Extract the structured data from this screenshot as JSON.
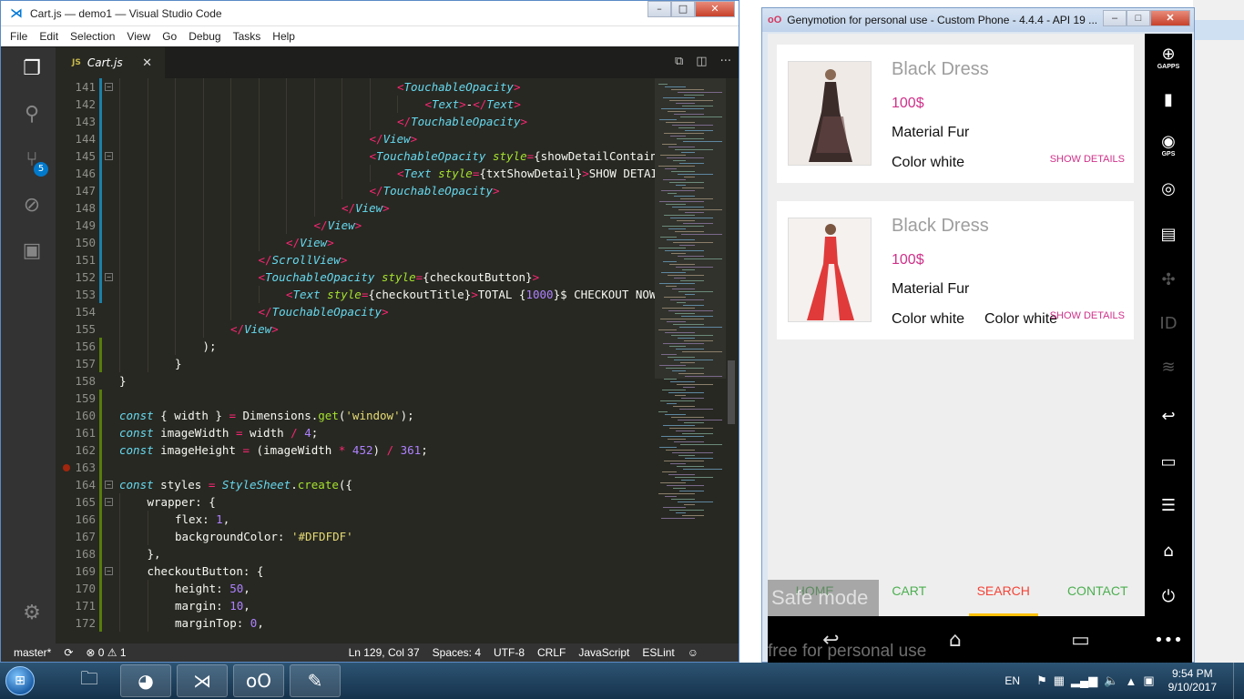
{
  "vscode": {
    "title": "Cart.js — demo1 — Visual Studio Code",
    "menu": [
      "File",
      "Edit",
      "Selection",
      "View",
      "Go",
      "Debug",
      "Tasks",
      "Help"
    ],
    "tab": {
      "type": "JS",
      "name": "Cart.js"
    },
    "scm_badge": "5",
    "status": {
      "branch": "master*",
      "problems": "⊗ 0 ⚠ 1",
      "position": "Ln 129, Col 37",
      "spaces": "Spaces: 4",
      "encoding": "UTF-8",
      "eol": "CRLF",
      "language": "JavaScript",
      "linter": "ESLint"
    }
  },
  "code_lines": [
    {
      "n": "141",
      "fold": true,
      "html": "<span class='op'>&lt;</span><span class='tag'>TouchableOpacity</span><span class='op'>&gt;</span>",
      "indent": 10
    },
    {
      "n": "142",
      "html": "<span class='op'>&lt;</span><span class='tag'>Text</span><span class='op'>&gt;</span>-<span class='op'>&lt;/</span><span class='tag'>Text</span><span class='op'>&gt;</span>",
      "indent": 11
    },
    {
      "n": "143",
      "html": "<span class='op'>&lt;/</span><span class='tag'>TouchableOpacity</span><span class='op'>&gt;</span>",
      "indent": 10
    },
    {
      "n": "144",
      "html": "<span class='op'>&lt;/</span><span class='tag'>View</span><span class='op'>&gt;</span>",
      "indent": 9
    },
    {
      "n": "145",
      "fold": true,
      "html": "<span class='op'>&lt;</span><span class='tag'>TouchableOpacity</span> <span class='attr'>style</span><span class='op'>=</span>{showDetailContainer",
      "indent": 9
    },
    {
      "n": "146",
      "html": "<span class='op'>&lt;</span><span class='tag'>Text</span> <span class='attr'>style</span><span class='op'>=</span>{txtShowDetail}<span class='op'>&gt;</span>SHOW DETAILS",
      "indent": 10
    },
    {
      "n": "147",
      "html": "<span class='op'>&lt;/</span><span class='tag'>TouchableOpacity</span><span class='op'>&gt;</span>",
      "indent": 9
    },
    {
      "n": "148",
      "html": "<span class='op'>&lt;/</span><span class='tag'>View</span><span class='op'>&gt;</span>",
      "indent": 8
    },
    {
      "n": "149",
      "html": "<span class='op'>&lt;/</span><span class='tag'>View</span><span class='op'>&gt;</span>",
      "indent": 7
    },
    {
      "n": "150",
      "html": "<span class='op'>&lt;/</span><span class='tag'>View</span><span class='op'>&gt;</span>",
      "indent": 6
    },
    {
      "n": "151",
      "html": "<span class='op'>&lt;/</span><span class='tag'>ScrollView</span><span class='op'>&gt;</span>",
      "indent": 5
    },
    {
      "n": "152",
      "fold": true,
      "html": "<span class='op'>&lt;</span><span class='tag'>TouchableOpacity</span> <span class='attr'>style</span><span class='op'>=</span>{checkoutButton}<span class='op'>&gt;</span>",
      "indent": 5
    },
    {
      "n": "153",
      "html": "<span class='op'>&lt;</span><span class='tag'>Text</span> <span class='attr'>style</span><span class='op'>=</span>{checkoutTitle}<span class='op'>&gt;</span>TOTAL {<span class='num'>1000</span>}$ CHECKOUT NOW<span class='op'>&lt;/</span>",
      "indent": 6
    },
    {
      "n": "154",
      "html": "<span class='op'>&lt;/</span><span class='tag'>TouchableOpacity</span><span class='op'>&gt;</span>",
      "indent": 5
    },
    {
      "n": "155",
      "html": "<span class='op'>&lt;/</span><span class='tag'>View</span><span class='op'>&gt;</span>",
      "indent": 4
    },
    {
      "n": "156",
      "html": ");",
      "indent": 3
    },
    {
      "n": "157",
      "html": "}",
      "indent": 2
    },
    {
      "n": "158",
      "html": "}",
      "indent": 0
    },
    {
      "n": "159",
      "html": "",
      "indent": 0
    },
    {
      "n": "160",
      "html": "<span class='kw'>const</span> { width } <span class='op'>=</span> Dimensions.<span class='fn'>get</span>(<span class='str'>'window'</span>);",
      "indent": 0
    },
    {
      "n": "161",
      "html": "<span class='kw'>const</span> imageWidth <span class='op'>=</span> width <span class='op'>/</span> <span class='num'>4</span>;",
      "indent": 0
    },
    {
      "n": "162",
      "html": "<span class='kw'>const</span> imageHeight <span class='op'>=</span> (imageWidth <span class='op'>*</span> <span class='num'>452</span>) <span class='op'>/</span> <span class='num'>361</span>;",
      "indent": 0
    },
    {
      "n": "163",
      "breakpoint": true,
      "html": "",
      "indent": 0
    },
    {
      "n": "164",
      "fold": true,
      "html": "<span class='kw'>const</span> styles <span class='op'>=</span> <span class='kw'>StyleSheet</span>.<span class='fn'>create</span>({",
      "indent": 0
    },
    {
      "n": "165",
      "fold": true,
      "html": "wrapper: {",
      "indent": 1
    },
    {
      "n": "166",
      "html": "flex: <span class='num'>1</span>,",
      "indent": 2
    },
    {
      "n": "167",
      "html": "backgroundColor: <span class='str'>'#DFDFDF'</span>",
      "indent": 2
    },
    {
      "n": "168",
      "html": "},",
      "indent": 1
    },
    {
      "n": "169",
      "fold": true,
      "html": "checkoutButton: {",
      "indent": 1
    },
    {
      "n": "170",
      "html": "height: <span class='num'>50</span>,",
      "indent": 2
    },
    {
      "n": "171",
      "html": "margin: <span class='num'>10</span>,",
      "indent": 2
    },
    {
      "n": "172",
      "html": "marginTop: <span class='num'>0</span>,",
      "indent": 2
    }
  ],
  "genymotion": {
    "title": "Genymotion for personal use - Custom Phone - 4.4.4 - API 19 ...",
    "products": [
      {
        "name": "Black Dress",
        "price": "100$",
        "material": "Material Fur",
        "colors": [
          "Color white"
        ],
        "details": "SHOW DETAILS"
      },
      {
        "name": "Black Dress",
        "price": "100$",
        "material": "Material Fur",
        "colors": [
          "Color white",
          "Color white"
        ],
        "details": "SHOW DETAILS"
      }
    ],
    "nav": [
      "HOME",
      "CART",
      "SEARCH",
      "CONTACT"
    ],
    "nav_active": 2,
    "safe_mode": "Safe mode",
    "watermark": "free for personal use",
    "side_labels": {
      "gapps": "GAPPS",
      "gps": "GPS",
      "id": "ID"
    }
  },
  "taskbar": {
    "lang": "EN",
    "time": "9:54 PM",
    "date": "9/10/2017"
  },
  "colors": {
    "accent_pink": "#d0318a",
    "nav_green": "#4caf50",
    "nav_active": "#f44336"
  }
}
